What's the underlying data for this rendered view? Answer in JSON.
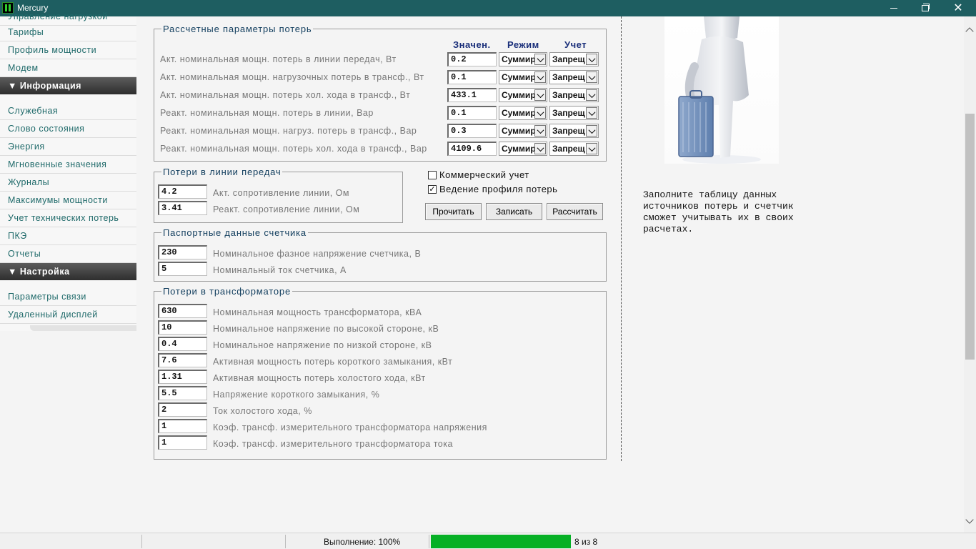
{
  "window": {
    "title": "Mercury"
  },
  "sidebar": {
    "top_cut_item": "Управление нагрузкой",
    "items_a": [
      "Тарифы",
      "Профиль мощности",
      "Модем"
    ],
    "header_info": "Информация",
    "items_b": [
      "Служебная",
      "Слово состояния",
      "Энергия",
      "Мгновенные значения",
      "Журналы",
      "Максимумы мощности",
      "Учет технических потерь",
      "ПКЭ",
      "Отчеты"
    ],
    "header_settings": "Настройка",
    "items_c": [
      "Параметры связи",
      "Удаленный дисплей"
    ]
  },
  "calc": {
    "legend": "Рассчетные параметры потерь",
    "col_value": "Значен.",
    "col_mode": "Режим",
    "col_account": "Учет",
    "rows": [
      {
        "label": "Акт. номинальная мощн. потерь в линии передач, Вт",
        "value": "0.2",
        "mode": "Суммир",
        "account": "Запрещ"
      },
      {
        "label": "Акт. номинальная мощн. нагрузочных потерь в трансф., Вт",
        "value": "0.1",
        "mode": "Суммир",
        "account": "Запрещ"
      },
      {
        "label": "Акт. номинальная мощн. потерь хол. хода в трансф., Вт",
        "value": "433.1",
        "mode": "Суммир",
        "account": "Запрещ"
      },
      {
        "label": "Реакт. номинальная мощн. потерь в линии, Вар",
        "value": "0.1",
        "mode": "Суммир",
        "account": "Запрещ"
      },
      {
        "label": "Реакт. номинальная мощн. нагруз. потерь в трансф., Вар",
        "value": "0.3",
        "mode": "Суммир",
        "account": "Запрещ"
      },
      {
        "label": "Реакт. номинальная мощн. потерь хол. хода в трансф., Вар",
        "value": "4109.6",
        "mode": "Суммир",
        "account": "Запрещ"
      }
    ]
  },
  "line": {
    "legend": "Потери в линии передач",
    "rows": [
      {
        "value": "4.2",
        "label": "Акт. сопротивление линии, Ом"
      },
      {
        "value": "3.41",
        "label": "Реакт. сопротивление линии, Ом"
      }
    ]
  },
  "options": {
    "commercial": {
      "label": "Коммерческий учет",
      "checked": false
    },
    "profile": {
      "label": "Ведение профиля потерь",
      "checked": true
    },
    "read_label": "Прочитать",
    "write_label": "Записать",
    "calc_label": "Рассчитать"
  },
  "passport": {
    "legend": "Паспортные данные счетчика",
    "rows": [
      {
        "value": "230",
        "label": "Номинальное фазное напряжение счетчика, В"
      },
      {
        "value": "5",
        "label": "Номинальный ток счетчика, А"
      }
    ]
  },
  "transformer": {
    "legend": "Потери в трансформаторе",
    "rows": [
      {
        "value": "630",
        "label": "Номинальная мощность трансформатора, кВА"
      },
      {
        "value": "10",
        "label": "Номинальное напряжение по высокой стороне, кВ"
      },
      {
        "value": "0.4",
        "label": "Номинальное напряжение по низкой стороне, кВ"
      },
      {
        "value": "7.6",
        "label": "Активная мощность потерь короткого замыкания, кВт"
      },
      {
        "value": "1.31",
        "label": "Активная мощность потерь холостого хода, кВт"
      },
      {
        "value": "5.5",
        "label": "Напряжение короткого замыкания, %"
      },
      {
        "value": "2",
        "label": "Ток холостого хода, %"
      },
      {
        "value": "1",
        "label": "Коэф. трансф. измерительного трансформатора напряжения"
      },
      {
        "value": "1",
        "label": "Коэф. трансф. измерительного трансформатора тока"
      }
    ]
  },
  "hint": {
    "lines": [
      "Заполните таблицу данных",
      "источников потерь и счетчик",
      "сможет учитывать их в своих",
      "расчетах."
    ]
  },
  "status": {
    "exec_text": "Выполнение: 100%",
    "progress": 1.0,
    "count_text": "8 из 8"
  },
  "colors": {
    "titlebar": "#1e5e61",
    "sidebar_link": "#1f6a6a",
    "progress": "#06b025",
    "legend": "#123e5e"
  }
}
